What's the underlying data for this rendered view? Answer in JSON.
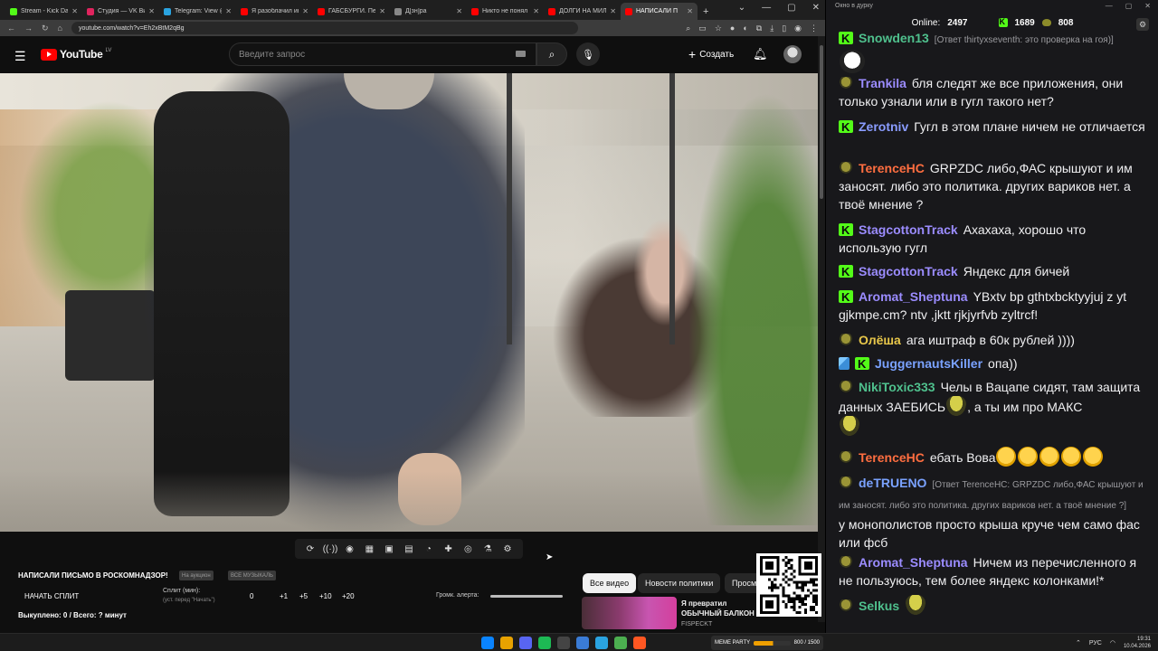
{
  "browser": {
    "tabs": [
      {
        "title": "Stream - Kick Dashb",
        "color": "#53fc18"
      },
      {
        "title": "Студия — VK Видео",
        "color": "#e0245e"
      },
      {
        "title": "Telegram: View @",
        "color": "#2aa3e0"
      },
      {
        "title": "Я разоблачил инд",
        "color": "#ff0000"
      },
      {
        "title": "ГАБСБУРГИ. Перев",
        "color": "#ff0000"
      },
      {
        "title": "Д[зн]ра",
        "color": "#888888"
      },
      {
        "title": "Никто не понял П",
        "color": "#ff0000"
      },
      {
        "title": "ДОЛГИ НА МИЛЛ",
        "color": "#ff0000"
      },
      {
        "title": "НАПИСАЛИ П",
        "color": "#ff0000"
      }
    ],
    "new_tab": "+",
    "url": "youtube.com/watch?v=Eh2xBtM2qBg",
    "window_controls": [
      "⌄",
      "—",
      "▢",
      "✕"
    ]
  },
  "youtube": {
    "logo_text": "YouTube",
    "country": "LV",
    "search_placeholder": "Введите запрос",
    "create_label": "Создать",
    "chips": [
      "Все видео",
      "Новости политики",
      "Просм"
    ],
    "recommendation": {
      "title": "Я превратил ОБЫЧНЫЙ БАЛКОН в ГЕЙМЕРСКИЙ",
      "channel": "FISPECKT"
    }
  },
  "player_controls": [
    "⟳",
    "((·))",
    "◉",
    "▦",
    "▣",
    "▤",
    "◔",
    "✚",
    "◎",
    "⚗",
    "⚙"
  ],
  "extension": {
    "title": "НАПИСАЛИ ПИСЬМО В РОСКОМНАДЗОР!",
    "pill_1": "На аукцион",
    "pill_2": "ВСЕ МУЗЫКАЛЬ",
    "split_button": "НАЧАТЬ СПЛИТ",
    "split_label": "Сплит (мин):",
    "split_sub": "(уст. перед \"Начать\")",
    "split_values": [
      "0",
      "+1",
      "+5",
      "+10",
      "+20"
    ],
    "volume_label": "Громк. алерта:",
    "bought": "Выкуплено: 0 / Всего: ? минут"
  },
  "chat": {
    "window_title": "Окно в дурку",
    "online_label": "Online:",
    "online_count": "2497",
    "kick_count": "1689",
    "other_count": "808",
    "messages": [
      {
        "badge": "k",
        "user": "Snowden13",
        "color": "#4fc08d",
        "reply": "[Ответ thirtyxseventh: это проверка на гоя)]",
        "text": ""
      },
      {
        "badge": "p",
        "user": "Trankila",
        "color": "#9b8cff",
        "reply": "",
        "text": "бля следят же все приложения, они только узнали или в гугл такого нет?"
      },
      {
        "badge": "k",
        "user": "Zerotniv",
        "color": "#8a9cff",
        "reply": "",
        "text": "Гугл в этом плане ничем не отличается"
      },
      {
        "badge": "p",
        "user": "TerenceHC",
        "color": "#ff6e40",
        "reply": "",
        "text": "GRPZDC либо,ФАС крышуют и им заносят. либо это политика. других вариков нет. а твоё мнение ?"
      },
      {
        "badge": "k",
        "user": "StagcottonTrack",
        "color": "#9b8cff",
        "reply": "",
        "text": "Ахахаха, хорошо что использую гугл"
      },
      {
        "badge": "k",
        "user": "StagcottonTrack",
        "color": "#9b8cff",
        "reply": "",
        "text": "Яндекс для бичей"
      },
      {
        "badge": "k",
        "user": "Aromat_Sheptuna",
        "color": "#9b8cff",
        "reply": "",
        "text": "YBxtv bp gthtxbcktyyjuj z yt gjkmpe.cm? ntv ,jktt rjkjyrfvb zyltrcf!"
      },
      {
        "badge": "p",
        "user": "Олёша",
        "color": "#e9c84a",
        "reply": "",
        "text": "ага иштраф в 60к рублей ))))"
      },
      {
        "badge": "sk",
        "user": "JuggernautsKiller",
        "color": "#7aa2ff",
        "reply": "",
        "text": "опа))"
      },
      {
        "badge": "p",
        "user": "NikiToxic333",
        "color": "#4fc08d",
        "reply": "",
        "text": "Челы в Вацапе сидят, там защита данных ЗАЕБИСЬ",
        "text2": ", а ты им про МАКС"
      },
      {
        "badge": "p",
        "user": "TerenceHC",
        "color": "#ff6e40",
        "reply": "",
        "text": "ебать Вова"
      },
      {
        "badge": "p",
        "user": "deTRUENO",
        "color": "#7aa2ff",
        "reply": "[Ответ TerenceHC: GRPZDC либо,ФАС крышуют и им заносят. либо это политика. других вариков нет. а твоё мнение ?]",
        "text": "у монополистов просто крыша круче чем само фас или фсб"
      },
      {
        "badge": "p",
        "user": "Aromat_Sheptuna",
        "color": "#9b8cff",
        "reply": "",
        "text": "Ничем из перечисленного я не пользуюсь, тем более яндекс колонками!*"
      },
      {
        "badge": "p",
        "user": "Selkus",
        "color": "#4fc08d",
        "reply": "",
        "text": ""
      }
    ]
  },
  "taskbar": {
    "widget_label": "MEME PARTY",
    "widget_progress": "800 / 1500",
    "widget_fraction": 0.53,
    "lang": "РУС",
    "time": "19:31",
    "date": "10.04.2026",
    "icon_colors": [
      "#0a84ff",
      "#e8a200",
      "#5865f2",
      "#1db954",
      "#444",
      "#3a7bd5",
      "#2aa3e0",
      "#4caf50",
      "#ff5722"
    ]
  }
}
